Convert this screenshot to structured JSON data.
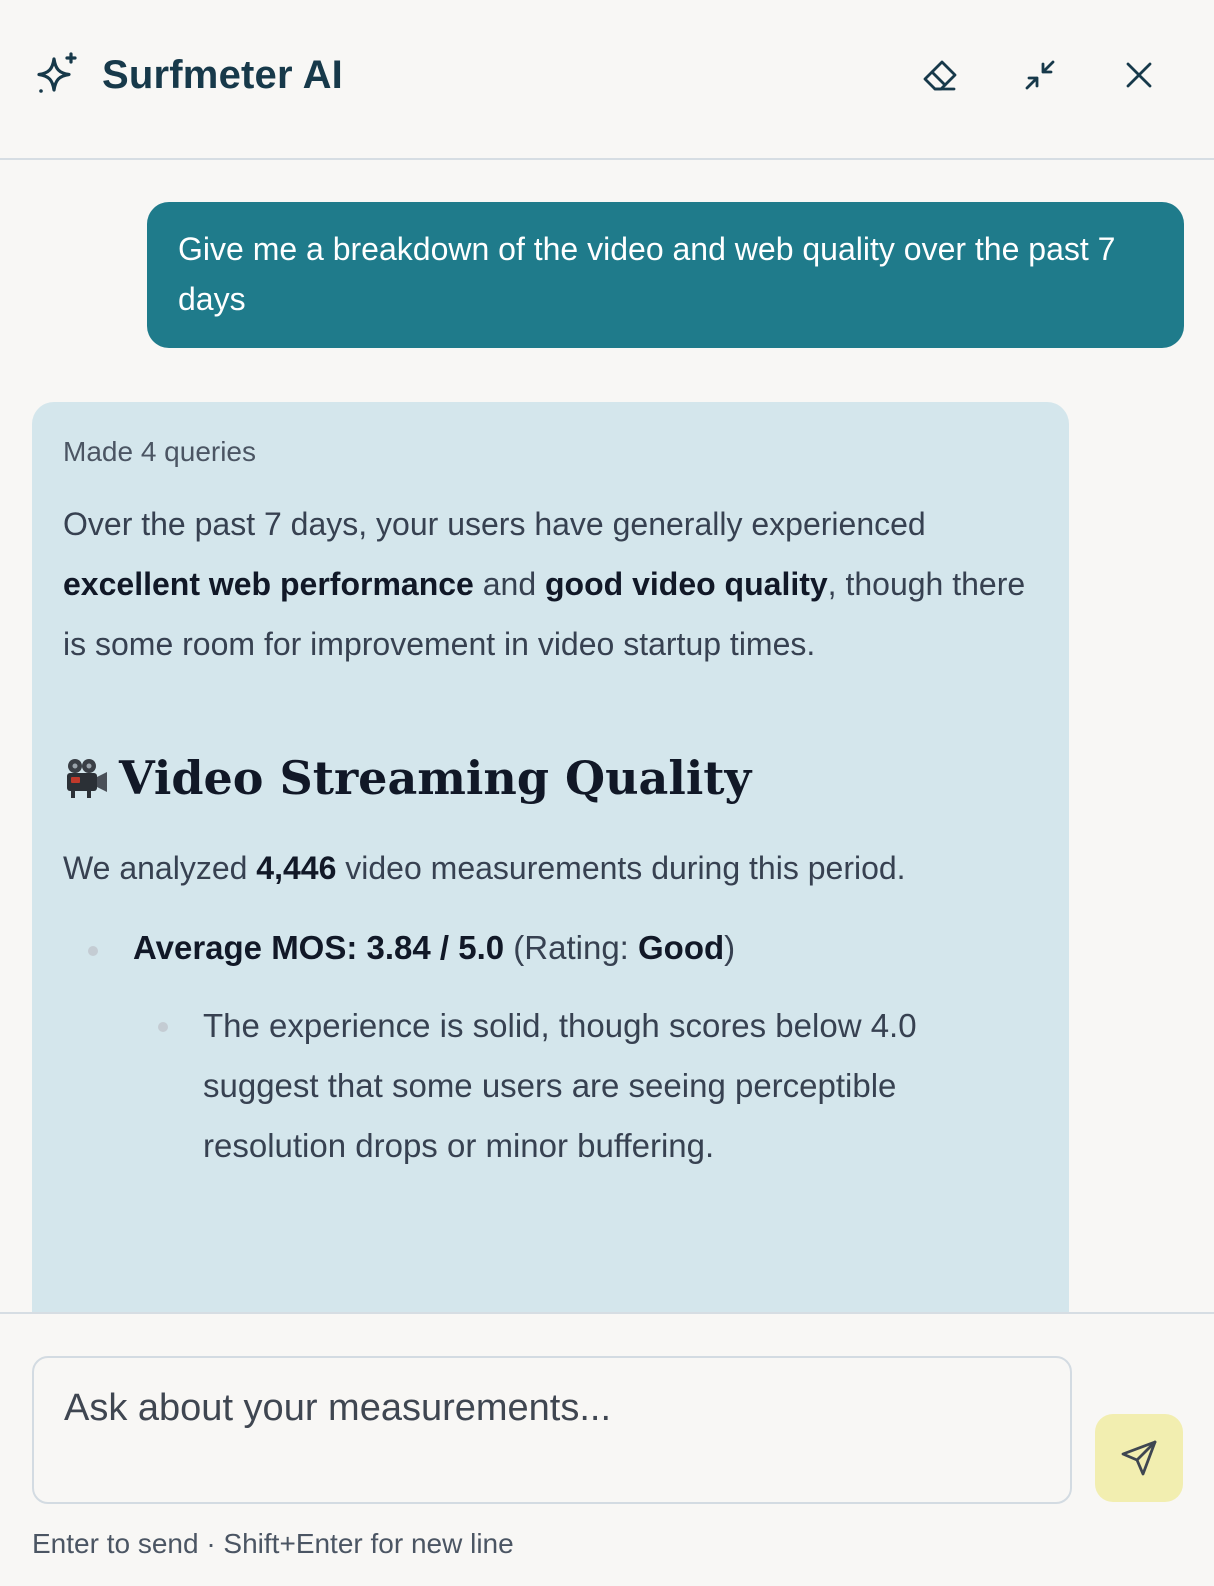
{
  "header": {
    "title": "Surfmeter AI",
    "icons": [
      "sparkles-icon",
      "eraser-icon",
      "minimize-icon",
      "close-icon"
    ]
  },
  "conversation": {
    "user_message": "Give me a breakdown of the video and web quality over the past 7 days",
    "assistant": {
      "queries_label": "Made 4 queries",
      "intro": {
        "part1": "Over the past 7 days, your users have generally experienced ",
        "bold1": "excellent web performance",
        "part2": " and ",
        "bold2": "good video quality",
        "part3": ", though there is some room for improvement in video startup times."
      },
      "section_title": "Video Streaming Quality",
      "section_emoji": "movie-camera-icon",
      "analyzed": {
        "prefix": "We analyzed ",
        "count": "4,446",
        "suffix": " video measurements during this period."
      },
      "bullet": {
        "bold_label": "Average MOS: 3.84 / 5.0",
        "rating_prefix": " (Rating: ",
        "rating_value": "Good",
        "rating_suffix": ")",
        "sub_bullet": "The experience is solid, though scores below 4.0 suggest that some users are seeing perceptible resolution drops or minor buffering."
      }
    }
  },
  "composer": {
    "placeholder": "Ask about your measurements...",
    "value": "",
    "hint": "Enter to send · Shift+Enter for new line",
    "send_icon": "send-icon"
  },
  "colors": {
    "brand": "#17394a",
    "user_bubble": "#1f7b8b",
    "assistant_bubble": "#d4e6ec",
    "send_button": "#f2eeb0"
  }
}
